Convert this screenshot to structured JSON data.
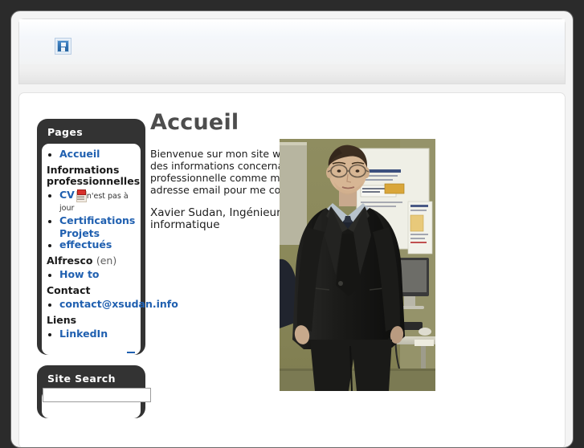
{
  "header": {
    "broken_image_alt": "broken-image-placeholder"
  },
  "sidebar": {
    "widgets": [
      {
        "title": "Pages",
        "collapse_label": "—",
        "items": [
          {
            "type": "link",
            "label": "Accueil",
            "name": "accueil"
          },
          {
            "type": "heading",
            "label": "Informations professionnelles",
            "suffix": ""
          },
          {
            "type": "link",
            "label": "CV",
            "name": "cv",
            "icon": "pdf-icon",
            "note": "n'est pas à jour"
          },
          {
            "type": "link",
            "label": "Certifications",
            "name": "certifications"
          },
          {
            "type": "link",
            "label": "Projets effectués",
            "name": "projets-effectues"
          },
          {
            "type": "heading",
            "label": "Alfresco",
            "suffix": "(en)"
          },
          {
            "type": "link",
            "label": "How to",
            "name": "how-to"
          },
          {
            "type": "heading",
            "label": "Contact",
            "suffix": ""
          },
          {
            "type": "link",
            "label": "contact@xsudan.info",
            "name": "contact-email"
          },
          {
            "type": "heading",
            "label": "Liens",
            "suffix": ""
          },
          {
            "type": "link",
            "label": "LinkedIn",
            "name": "linkedin"
          }
        ]
      },
      {
        "title": "Site Search",
        "search_value": "",
        "search_placeholder": ""
      }
    ]
  },
  "main": {
    "title": "Accueil",
    "paragraphs": [
      "Bienvenue sur mon site web. Vous trouverez ici des informations concernant ma vie professionnelle comme mon CV ou mon adresse email pour me contacter."
    ],
    "byline": "Xavier Sudan, Ingénieur HES en informatique",
    "photo_alt": "portrait-photo-man-in-suit-office"
  },
  "colors": {
    "frame": "#2b2b2b",
    "widget_header": "#333333",
    "link": "#2060b0",
    "title": "#4d4d4d",
    "page_bg": "#f4f4f4"
  }
}
